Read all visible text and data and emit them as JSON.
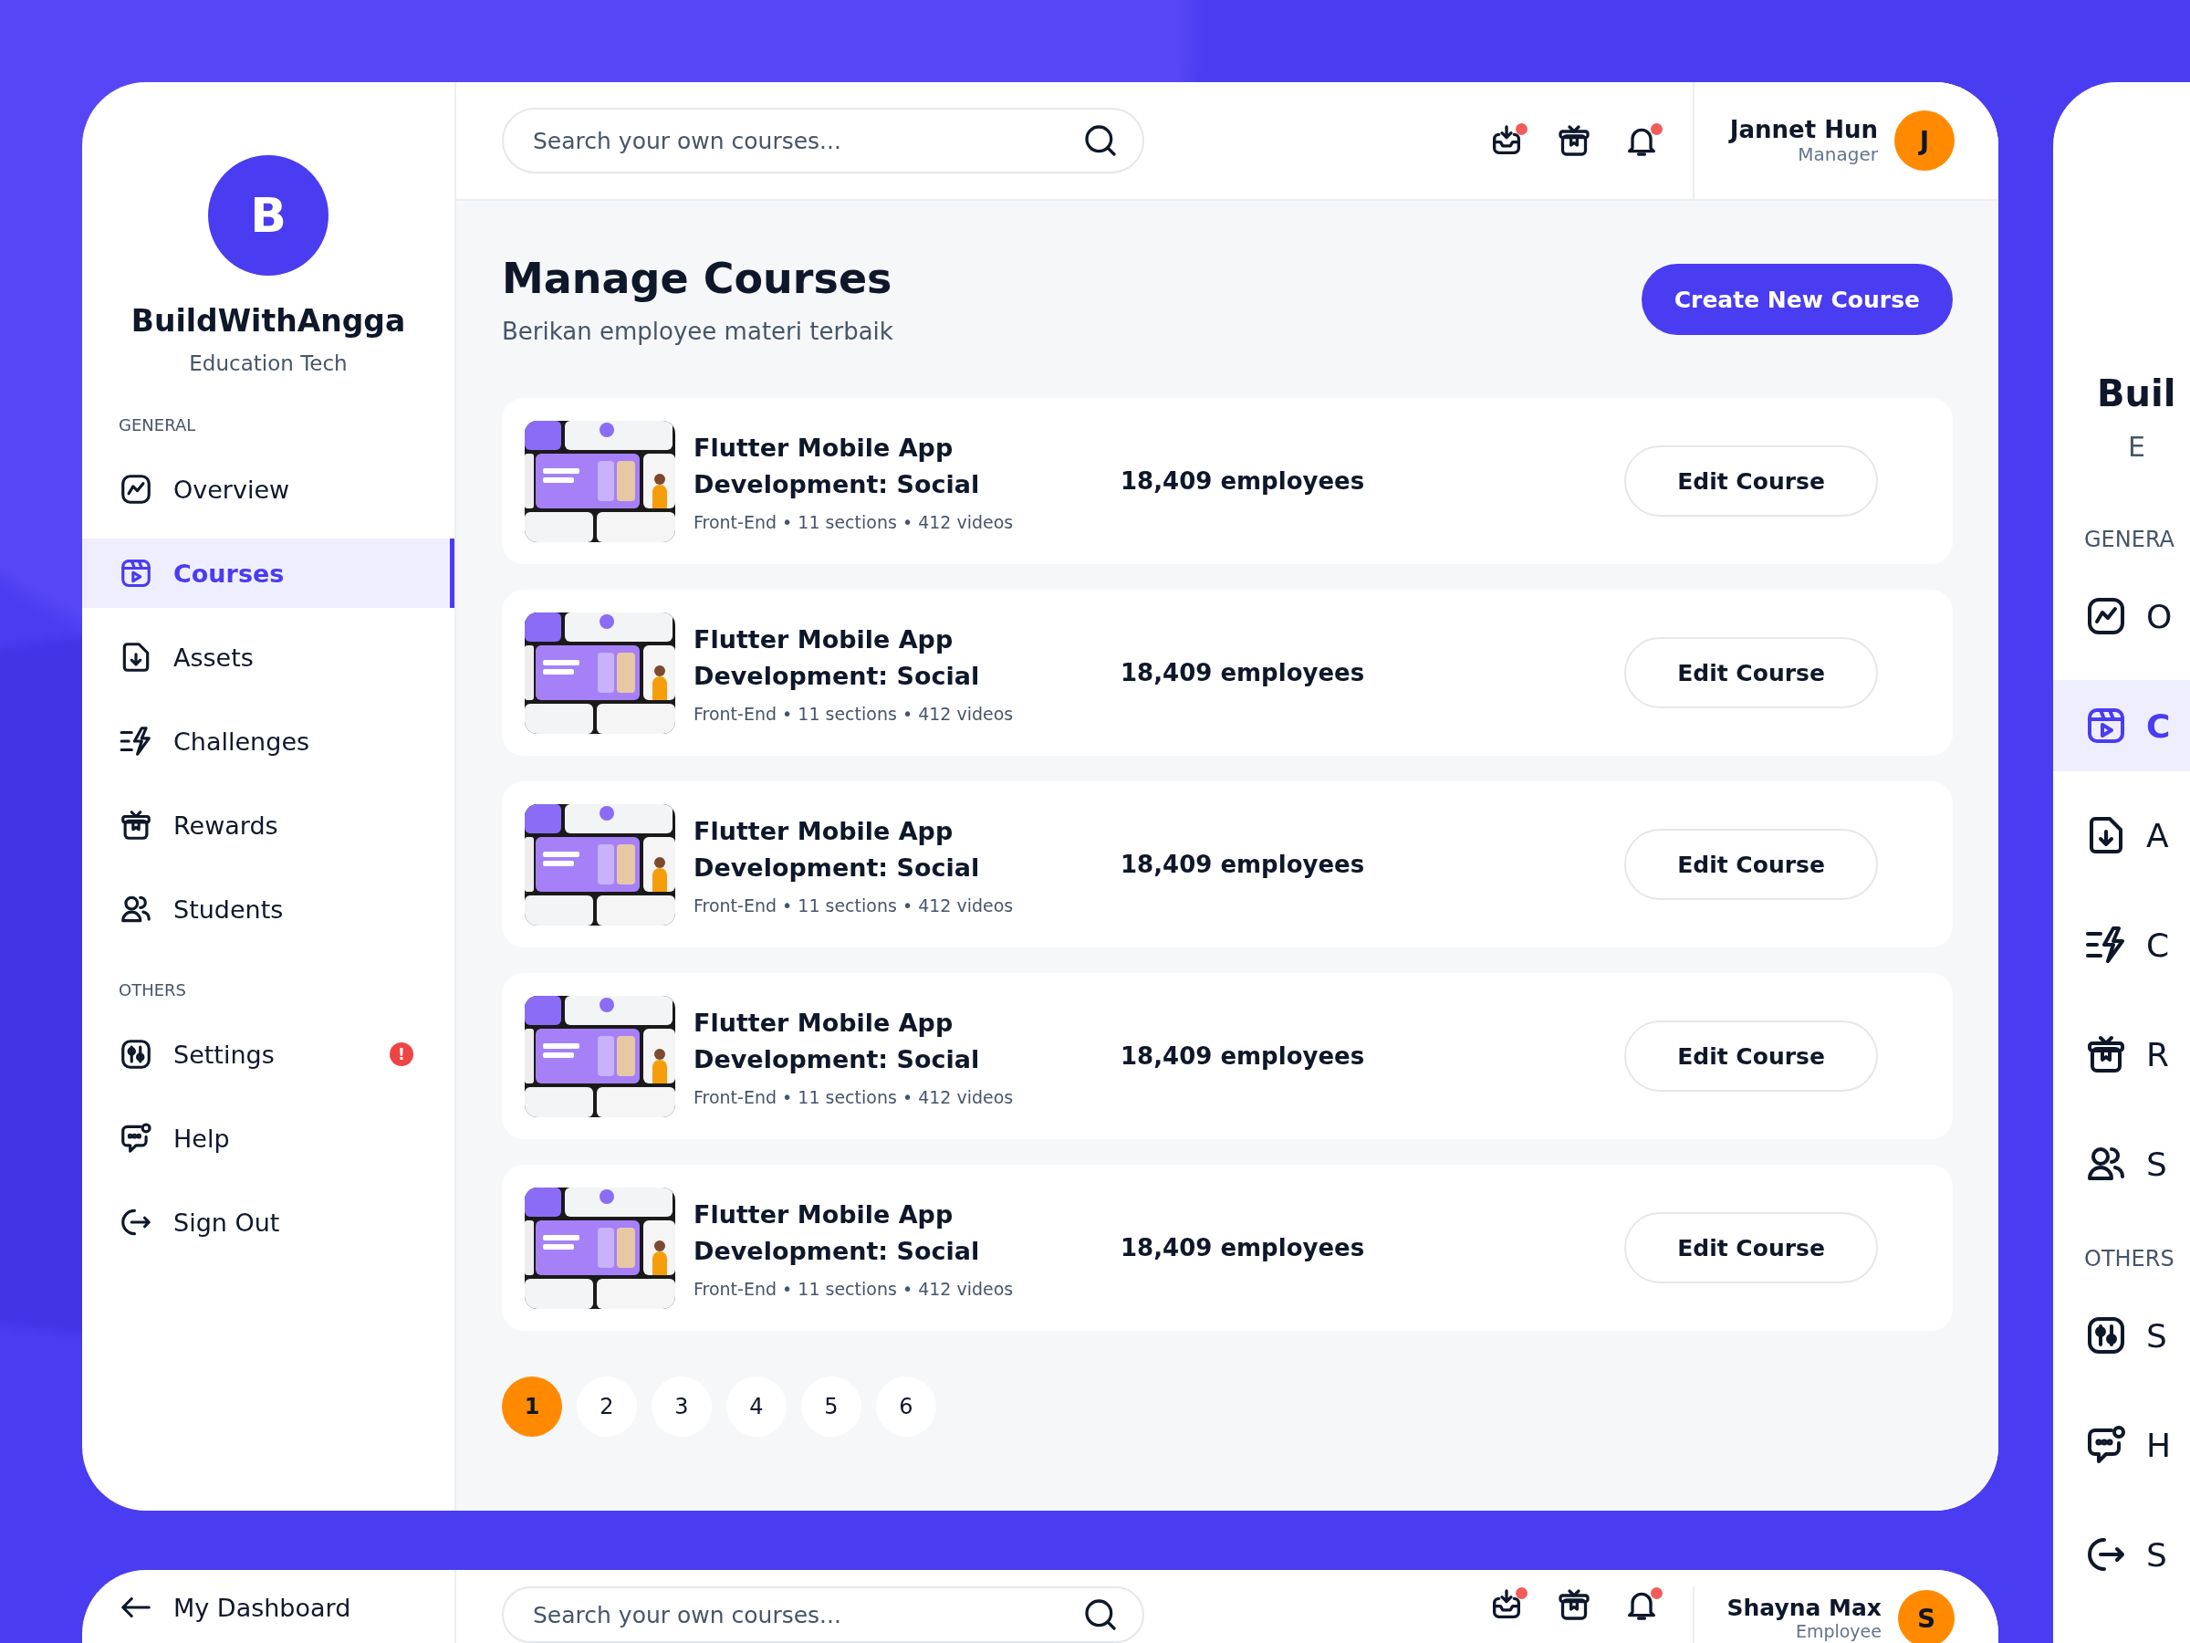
{
  "main": {
    "sidebar": {
      "brand": {
        "initial": "B",
        "name": "BuildWithAngga",
        "tagline": "Education Tech"
      },
      "sections": [
        {
          "heading": "GENERAL",
          "items": [
            {
              "kind": "overview",
              "label": "Overview",
              "selected": false
            },
            {
              "kind": "courses",
              "label": "Courses",
              "selected": true
            },
            {
              "kind": "assets",
              "label": "Assets",
              "selected": false
            },
            {
              "kind": "challenges",
              "label": "Challenges",
              "selected": false
            },
            {
              "kind": "rewards",
              "label": "Rewards",
              "selected": false
            },
            {
              "kind": "students",
              "label": "Students",
              "selected": false
            }
          ]
        },
        {
          "heading": "OTHERS",
          "items": [
            {
              "kind": "settings",
              "label": "Settings",
              "selected": false,
              "badge": "!"
            },
            {
              "kind": "help",
              "label": "Help",
              "selected": false
            },
            {
              "kind": "signout",
              "label": "Sign Out",
              "selected": false
            }
          ]
        }
      ]
    },
    "header": {
      "search": {
        "placeholder": "Search your own courses..."
      },
      "icons": [
        {
          "kind": "inbox",
          "badge": true
        },
        {
          "kind": "rewards",
          "badge": false
        },
        {
          "kind": "bell",
          "badge": true
        }
      ],
      "user": {
        "name": "Jannet Hun",
        "role": "Manager",
        "initial": "J"
      }
    },
    "page": {
      "title": "Manage Courses",
      "subtitle": "Berikan employee materi terbaik",
      "create_button": "Create New Course"
    },
    "courses": [
      {
        "title": "Flutter Mobile App Development: Social",
        "meta": "Front-End • 11 sections • 412 videos",
        "employees": "18,409 employees",
        "button": "Edit Course"
      },
      {
        "title": "Flutter Mobile App Development: Social",
        "meta": "Front-End • 11 sections • 412 videos",
        "employees": "18,409 employees",
        "button": "Edit Course"
      },
      {
        "title": "Flutter Mobile App Development: Social",
        "meta": "Front-End • 11 sections • 412 videos",
        "employees": "18,409 employees",
        "button": "Edit Course"
      },
      {
        "title": "Flutter Mobile App Development: Social",
        "meta": "Front-End • 11 sections • 412 videos",
        "employees": "18,409 employees",
        "button": "Edit Course"
      },
      {
        "title": "Flutter Mobile App Development: Social",
        "meta": "Front-End • 11 sections • 412 videos",
        "employees": "18,409 employees",
        "button": "Edit Course"
      }
    ],
    "pagination": [
      {
        "label": "1",
        "selected": true
      },
      {
        "label": "2",
        "selected": false
      },
      {
        "label": "3",
        "selected": false
      },
      {
        "label": "4",
        "selected": false
      },
      {
        "label": "5",
        "selected": false
      },
      {
        "label": "6",
        "selected": false
      }
    ]
  },
  "side_preview": {
    "brand": {
      "name": "Buil",
      "tagline": "E"
    },
    "sections": [
      {
        "heading": "GENERA",
        "items": [
          {
            "kind": "overview",
            "label": "O",
            "selected": false
          },
          {
            "kind": "courses",
            "label": "C",
            "selected": true
          },
          {
            "kind": "assets",
            "label": "A",
            "selected": false
          },
          {
            "kind": "challenges",
            "label": "C",
            "selected": false
          },
          {
            "kind": "rewards",
            "label": "R",
            "selected": false
          },
          {
            "kind": "students",
            "label": "S",
            "selected": false
          }
        ]
      },
      {
        "heading": "OTHERS",
        "items": [
          {
            "kind": "settings",
            "label": "S",
            "selected": false
          },
          {
            "kind": "help",
            "label": "H",
            "selected": false
          },
          {
            "kind": "signout",
            "label": "S",
            "selected": false
          }
        ]
      }
    ]
  },
  "bottom_preview": {
    "back_link": "My Dashboard",
    "search": {
      "placeholder": "Search your own courses..."
    },
    "icons": [
      {
        "kind": "inbox",
        "badge": true
      },
      {
        "kind": "rewards",
        "badge": false
      },
      {
        "kind": "bell",
        "badge": true
      }
    ],
    "user": {
      "name": "Shayna Max",
      "role": "Employee",
      "initial": "S"
    }
  }
}
